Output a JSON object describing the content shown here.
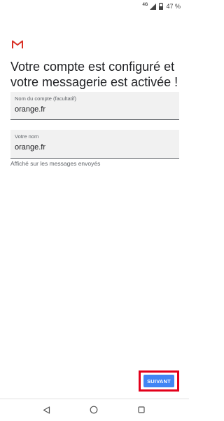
{
  "status_bar": {
    "network": "4G",
    "battery_percent": "47 %"
  },
  "title": "Votre compte est configuré et votre messagerie est activée !",
  "fields": [
    {
      "label": "Nom du compte (facultatif)",
      "value": "orange.fr"
    },
    {
      "label": "Votre nom",
      "value": "orange.fr"
    }
  ],
  "helper_text": "Affiché sur les messages envoyés",
  "next_button": {
    "label": "SUIVANT"
  },
  "colors": {
    "accent": "#4285f4",
    "highlight": "#e3001b",
    "gmail_red": "#d93025"
  },
  "icons": {
    "logo": "gmail-logo",
    "nav": [
      "back-icon",
      "home-icon",
      "recents-icon"
    ]
  }
}
